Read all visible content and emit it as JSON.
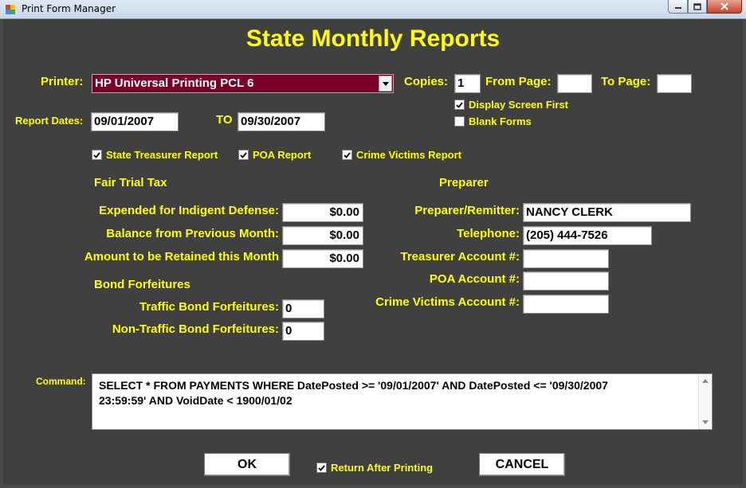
{
  "window": {
    "title": "Print Form Manager"
  },
  "form": {
    "heading": "State Monthly Reports",
    "printer": {
      "label": "Printer:",
      "value": "HP Universal Printing PCL 6"
    },
    "copies": {
      "label": "Copies:",
      "value": "1"
    },
    "from_page": {
      "label": "From Page:",
      "value": ""
    },
    "to_page": {
      "label": "To Page:",
      "value": ""
    },
    "display_screen_first": {
      "label": "Display Screen First",
      "checked": true
    },
    "blank_forms": {
      "label": "Blank Forms",
      "checked": false
    },
    "report_dates": {
      "label": "Report Dates:",
      "from": "09/01/2007",
      "to_label": "TO",
      "to": "09/30/2007"
    },
    "reports": [
      {
        "label": "State Treasurer Report",
        "checked": true
      },
      {
        "label": "POA Report",
        "checked": true
      },
      {
        "label": "Crime Victims Report",
        "checked": true
      }
    ],
    "fair_trial_tax": {
      "heading": "Fair Trial Tax",
      "expended_label": "Expended for Indigent Defense:",
      "expended_value": "$0.00",
      "balance_label": "Balance from Previous Month:",
      "balance_value": "$0.00",
      "retained_label": "Amount to be Retained this Month",
      "retained_value": "$0.00"
    },
    "bond_forfeitures": {
      "heading": "Bond Forfeitures",
      "traffic_label": "Traffic Bond Forfeitures:",
      "traffic_value": "0",
      "non_traffic_label": "Non-Traffic Bond Forfeitures:",
      "non_traffic_value": "0"
    },
    "preparer": {
      "heading": "Preparer",
      "remitter_label": "Preparer/Remitter:",
      "remitter_value": "NANCY CLERK",
      "telephone_label": "Telephone:",
      "telephone_value": "(205) 444-7526",
      "treasurer_label": "Treasurer Account #:",
      "treasurer_value": "",
      "poa_label": "POA Account #:",
      "poa_value": "",
      "crime_label": "Crime Victims Account #:",
      "crime_value": ""
    },
    "command": {
      "label": "Command:",
      "line1": "SELECT * FROM PAYMENTS WHERE DatePosted >= '09/01/2007' AND DatePosted <= '09/30/2007",
      "line2": "23:59:59' AND VoidDate < 1900/01/02"
    },
    "ok_label": "OK",
    "return_after_printing": {
      "label": "Return After Printing",
      "checked": true
    },
    "cancel_label": "CANCEL"
  },
  "colors": {
    "background": "#404040",
    "label": "#ffff00",
    "printer_select": "#7a0028"
  }
}
